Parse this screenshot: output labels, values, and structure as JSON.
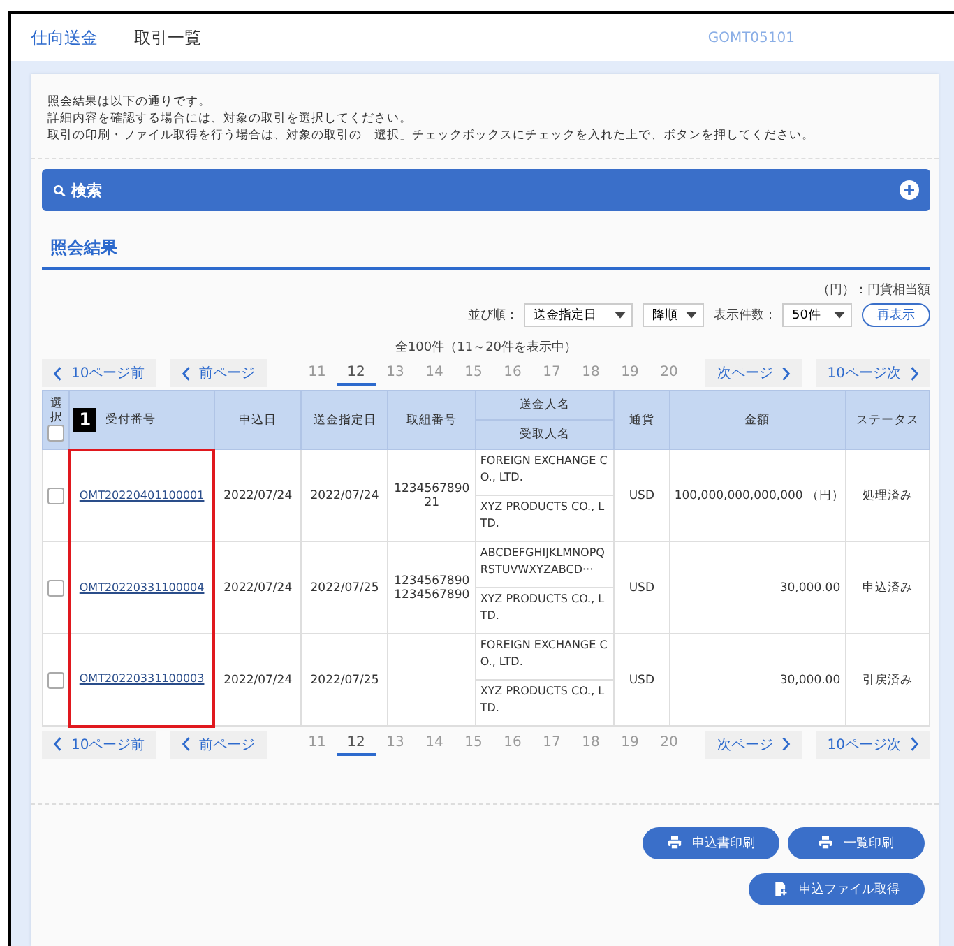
{
  "header": {
    "category": "仕向送金",
    "title": "取引一覧",
    "screen_id": "GOMT05101"
  },
  "intro": [
    "照会結果は以下の通りです。",
    "詳細内容を確認する場合には、対象の取引を選択してください。",
    "取引の印刷・ファイル取得を行う場合は、対象の取引の「選択」チェックボックスにチェックを入れた上で、ボタンを押してください。"
  ],
  "search": {
    "label": "検索",
    "expanded": false
  },
  "results": {
    "heading": "照会結果",
    "unit_note": "（円）：円貨相当額",
    "sort": {
      "label": "並び順：",
      "field": "送金指定日",
      "order": "降順"
    },
    "page_size": {
      "label": "表示件数：",
      "value": "50件"
    },
    "refresh_button": "再表示",
    "summary": "全100件（11～20件を表示中）",
    "pagination_top": {
      "prev10": "10ページ前",
      "prev": "前ページ",
      "next": "次ページ",
      "next10": "10ページ次",
      "pages": [
        {
          "label": "11",
          "selected": false
        },
        {
          "label": "12",
          "selected": true
        },
        {
          "label": "13",
          "selected": false
        },
        {
          "label": "14",
          "selected": false
        },
        {
          "label": "15",
          "selected": false
        },
        {
          "label": "16",
          "selected": false
        },
        {
          "label": "17",
          "selected": false
        },
        {
          "label": "18",
          "selected": false
        },
        {
          "label": "19",
          "selected": false
        },
        {
          "label": "20",
          "selected": false
        }
      ]
    },
    "pagination_bottom": {
      "prev10": "10ページ前",
      "prev": "前ページ",
      "next": "次ページ",
      "next10": "10ページ次",
      "pages": [
        {
          "label": "11",
          "selected": false
        },
        {
          "label": "12",
          "selected": true
        },
        {
          "label": "13",
          "selected": false
        },
        {
          "label": "14",
          "selected": false
        },
        {
          "label": "15",
          "selected": false
        },
        {
          "label": "16",
          "selected": false
        },
        {
          "label": "17",
          "selected": false
        },
        {
          "label": "18",
          "selected": false
        },
        {
          "label": "19",
          "selected": false
        },
        {
          "label": "20",
          "selected": false
        }
      ]
    },
    "table": {
      "columns": {
        "select": "選択",
        "receipt": "受付番号",
        "applied": "申込日",
        "transfer_date": "送金指定日",
        "deal_no": "取組番号",
        "sender": "送金人名",
        "receiver": "受取人名",
        "currency": "通貨",
        "amount": "金額",
        "status": "ステータス"
      },
      "select_all_checked": false,
      "annotation_badge": "1",
      "rows": [
        {
          "checked": false,
          "highlighted": true,
          "receipt": "OMT20220401100001",
          "applied": "2022/07/24",
          "transfer_date": "2022/07/24",
          "deal_no": "123456789021",
          "sender": "FOREIGN EXCHANGE CO., LTD.",
          "receiver": "XYZ PRODUCTS CO., LTD.",
          "currency": "USD",
          "amount": "100,000,000,000,000 （円）",
          "status": "処理済み"
        },
        {
          "checked": false,
          "highlighted": true,
          "receipt": "OMT20220331100004",
          "applied": "2022/07/24",
          "transfer_date": "2022/07/25",
          "deal_no": "12345678901234567890",
          "sender": "ABCDEFGHIJKLMNOPQRSTUVWXYZABCD···",
          "receiver": "XYZ PRODUCTS CO., LTD.",
          "currency": "USD",
          "amount": "30,000.00",
          "status": "申込済み"
        },
        {
          "checked": false,
          "highlighted": true,
          "receipt": "OMT20220331100003",
          "applied": "2022/07/24",
          "transfer_date": "2022/07/25",
          "deal_no": "",
          "sender": "FOREIGN EXCHANGE CO., LTD.",
          "receiver": "XYZ PRODUCTS CO., LTD.",
          "currency": "USD",
          "amount": "30,000.00",
          "status": "引戻済み"
        }
      ]
    }
  },
  "buttons": [
    {
      "kind": "print",
      "label": "申込書印刷"
    },
    {
      "kind": "print",
      "label": "一覧印刷"
    },
    {
      "kind": "file",
      "label": "申込ファイル取得"
    }
  ]
}
